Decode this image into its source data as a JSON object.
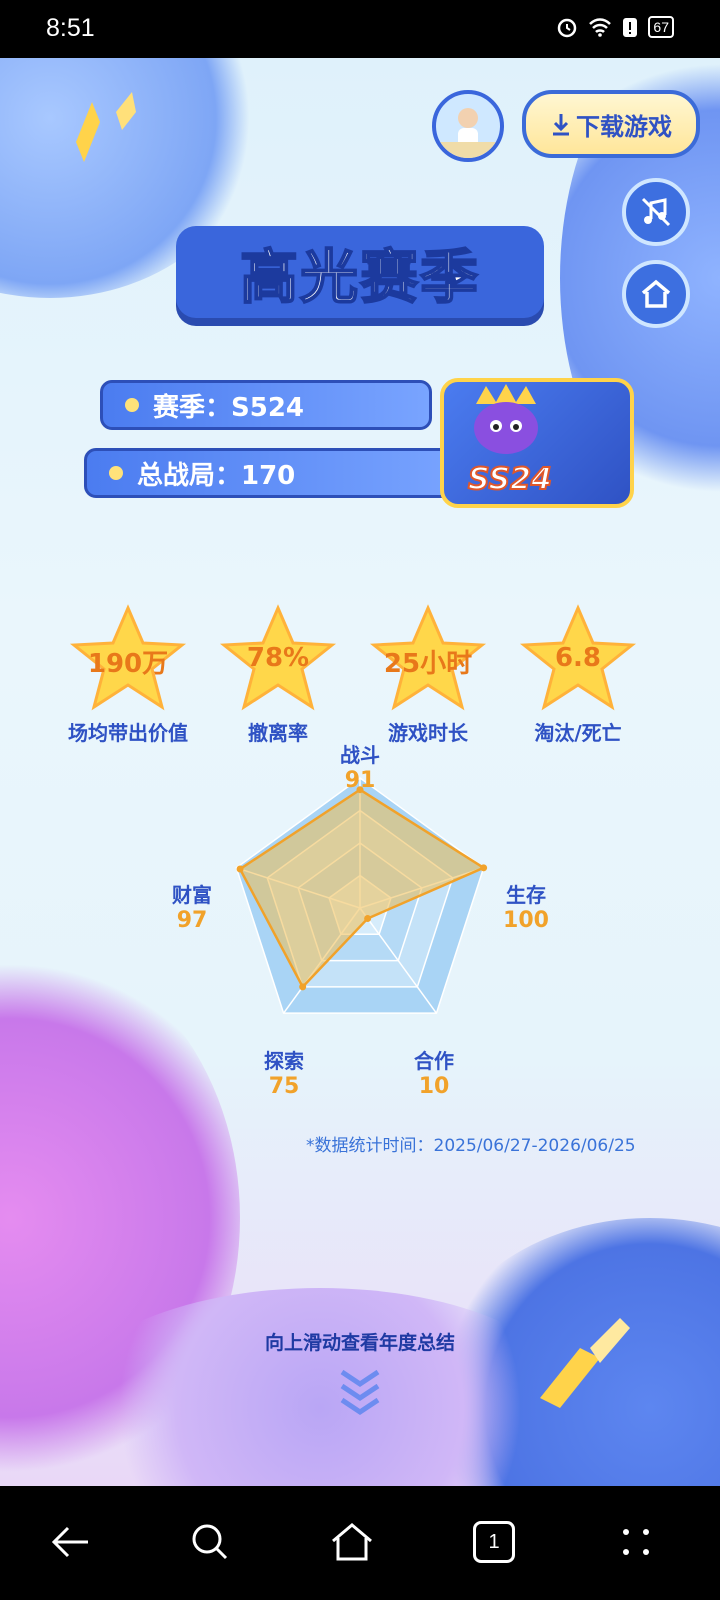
{
  "status_bar": {
    "time": "8:51",
    "battery": "67"
  },
  "header": {
    "download_label": "下载游戏"
  },
  "title": "高光赛季",
  "season": {
    "season_label": "赛季：S524",
    "total_label": "总战局：170",
    "badge": "SS24"
  },
  "stats": [
    {
      "value": "190万",
      "label": "场均带出价值"
    },
    {
      "value": "78%",
      "label": "撤离率"
    },
    {
      "value": "25小时",
      "label": "游戏时长"
    },
    {
      "value": "6.8",
      "label": "淘汰/死亡"
    }
  ],
  "radar": {
    "axes": [
      {
        "name": "战斗",
        "value": "91"
      },
      {
        "name": "生存",
        "value": "100"
      },
      {
        "name": "合作",
        "value": "10"
      },
      {
        "name": "探索",
        "value": "75"
      },
      {
        "name": "财富",
        "value": "97"
      }
    ]
  },
  "chart_data": {
    "type": "radar",
    "categories": [
      "战斗",
      "生存",
      "合作",
      "探索",
      "财富"
    ],
    "values": [
      91,
      100,
      10,
      75,
      97
    ],
    "max": 100
  },
  "note": "*数据统计时间：2025/06/27-2026/06/25",
  "swipe_hint": "向上滑动查看年度总结",
  "colors": {
    "accent": "#3a66dc",
    "orange": "#f1a22a",
    "star": "#ffd74a"
  },
  "icons": [
    "alarm-icon",
    "wifi-icon",
    "battery-icon",
    "music-off-icon",
    "home-icon",
    "back-icon",
    "search-icon",
    "home-nav-icon",
    "tabs-icon",
    "menu-icon"
  ],
  "nav": {
    "tabs_count": "1"
  }
}
